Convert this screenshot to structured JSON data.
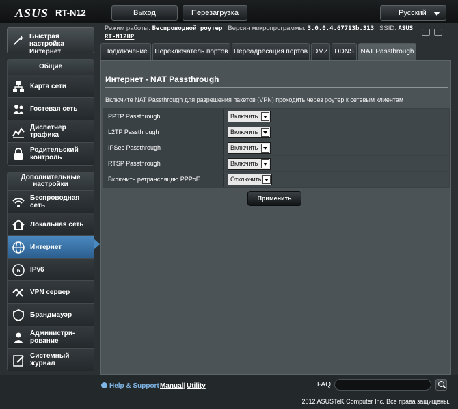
{
  "header": {
    "logo": "ASUS",
    "model": "RT-N12",
    "logout_label": "Выход",
    "reboot_label": "Перезагрузка",
    "language": "Русский"
  },
  "status": {
    "mode_label": "Режим работы:",
    "mode_value": "Беспроводной роутер",
    "firmware_label": "Версия микропрограммы:",
    "firmware_value": "3.0.0.4.67713b.313",
    "ssid_label": "SSID:",
    "ssid_value": "ASUS",
    "ssid_value2": "RT-N12HP"
  },
  "sidebar": {
    "quick_setup": "Быстрая настройка Интернет",
    "general_title": "Общие",
    "general_items": [
      {
        "label": "Карта сети",
        "icon": "network-map-icon"
      },
      {
        "label": "Гостевая сеть",
        "icon": "guest-network-icon"
      },
      {
        "label": "Диспетчер трафика",
        "icon": "traffic-manager-icon"
      },
      {
        "label": "Родительский контроль",
        "icon": "parental-control-icon"
      }
    ],
    "advanced_title": "Дополнительные настройки",
    "advanced_items": [
      {
        "label": "Беспроводная сеть",
        "icon": "wireless-icon"
      },
      {
        "label": "Локальная сеть",
        "icon": "lan-home-icon"
      },
      {
        "label": "Интернет",
        "icon": "globe-icon"
      },
      {
        "label": "IPv6",
        "icon": "ipv6-icon"
      },
      {
        "label": "VPN сервер",
        "icon": "vpn-icon"
      },
      {
        "label": "Брандмауэр",
        "icon": "firewall-shield-icon"
      },
      {
        "label": "Администри-рование",
        "icon": "admin-user-icon"
      },
      {
        "label": "Системный журнал",
        "icon": "system-log-icon"
      }
    ]
  },
  "tabs": [
    "Подключение",
    "Переключатель портов",
    "Переадресация портов",
    "DMZ",
    "DDNS",
    "NAT Passthrough"
  ],
  "main": {
    "title": "Интернет - NAT Passthrough",
    "description": "Включите NAT Passthrough для разрешения пакетов (VPN) проходить через роутер к сетевым клиентам",
    "rows": [
      {
        "label": "PPTP Passthrough",
        "value": "Включить"
      },
      {
        "label": "L2TP Passthrough",
        "value": "Включить"
      },
      {
        "label": "IPSec Passthrough",
        "value": "Включить"
      },
      {
        "label": "RTSP Passthrough",
        "value": "Включить"
      },
      {
        "label": "Включить ретрансляцию PPPoE",
        "value": "Отключить"
      }
    ],
    "apply_label": "Применить"
  },
  "footer": {
    "help": "Help & Support",
    "manual": "Manual",
    "separator": "|",
    "utility": "Utility",
    "faq": "FAQ",
    "copyright": "2012 ASUSTeK Computer Inc. Все права защищены."
  },
  "colors": {
    "active_menu": "#4a88c0",
    "panel": "#4b5357",
    "help_link": "#7fb6e6"
  }
}
